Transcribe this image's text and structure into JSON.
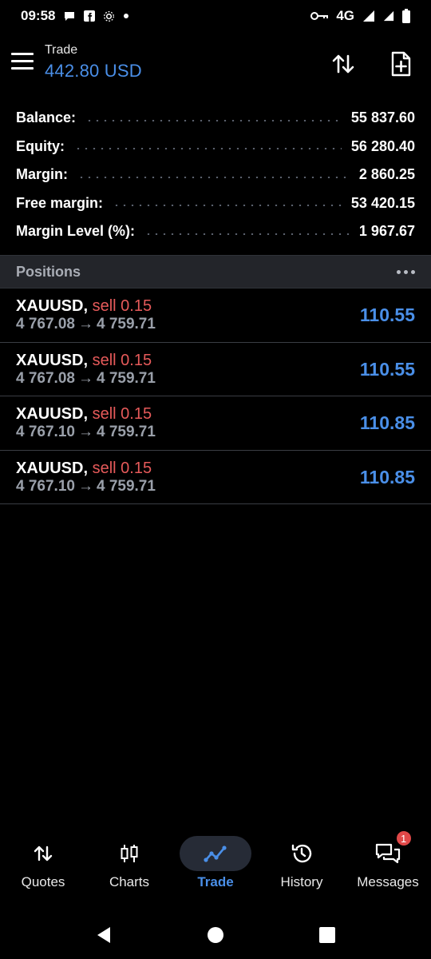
{
  "status_bar": {
    "time": "09:58",
    "network": "4G",
    "left_icons": [
      "chat-bubble-icon",
      "facebook-icon",
      "settings-gear-icon",
      "dot-icon"
    ],
    "right_icons": [
      "vpn-key-icon",
      "signal-icon",
      "battery-icon"
    ]
  },
  "header": {
    "title": "Trade",
    "subtitle": "442.80 USD"
  },
  "summary": [
    {
      "label": "Balance:",
      "value": "55 837.60"
    },
    {
      "label": "Equity:",
      "value": "56 280.40"
    },
    {
      "label": "Margin:",
      "value": "2 860.25"
    },
    {
      "label": "Free margin:",
      "value": "53 420.15"
    },
    {
      "label": "Margin Level (%):",
      "value": "1 967.67"
    }
  ],
  "positions_header": "Positions",
  "positions": [
    {
      "symbol": "XAUUSD,",
      "side": "sell 0.15",
      "open": "4 767.08",
      "arrow": "→",
      "current": "4 759.71",
      "profit": "110.55"
    },
    {
      "symbol": "XAUUSD,",
      "side": "sell 0.15",
      "open": "4 767.08",
      "arrow": "→",
      "current": "4 759.71",
      "profit": "110.55"
    },
    {
      "symbol": "XAUUSD,",
      "side": "sell 0.15",
      "open": "4 767.10",
      "arrow": "→",
      "current": "4 759.71",
      "profit": "110.85"
    },
    {
      "symbol": "XAUUSD,",
      "side": "sell 0.15",
      "open": "4 767.10",
      "arrow": "→",
      "current": "4 759.71",
      "profit": "110.85"
    }
  ],
  "bottom_nav": [
    {
      "label": "Quotes",
      "icon": "quotes-arrows-icon",
      "active": false
    },
    {
      "label": "Charts",
      "icon": "candlestick-icon",
      "active": false
    },
    {
      "label": "Trade",
      "icon": "trade-line-icon",
      "active": true
    },
    {
      "label": "History",
      "icon": "history-clock-icon",
      "active": false
    },
    {
      "label": "Messages",
      "icon": "messages-icon",
      "active": false,
      "badge": "1"
    }
  ],
  "colors": {
    "accent": "#4a8fe8",
    "sell": "#e65a5a",
    "background": "#000000",
    "section_header": "#23252a"
  }
}
